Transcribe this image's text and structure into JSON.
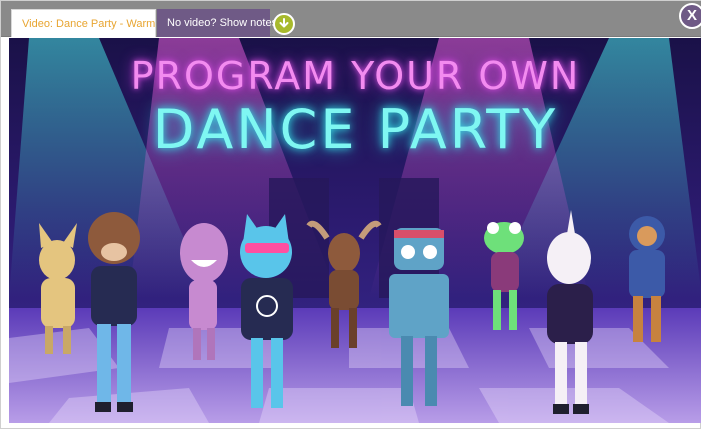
{
  "tabs": {
    "video_label": "Video: Dance Party - Warm Up",
    "notes_label": "No video? Show notes."
  },
  "controls": {
    "download_icon": "download-arrow-icon",
    "close_label": "X"
  },
  "video": {
    "title_line1": "PROGRAM YOUR OWN",
    "title_line2": "DANCE PARTY"
  },
  "colors": {
    "tab_video_text": "#e8a531",
    "tab_notes_bg": "#6f5a86",
    "download_button": "#a8ba2c",
    "title_line1": "#f38bf0",
    "title_line2": "#7ff7f2"
  }
}
